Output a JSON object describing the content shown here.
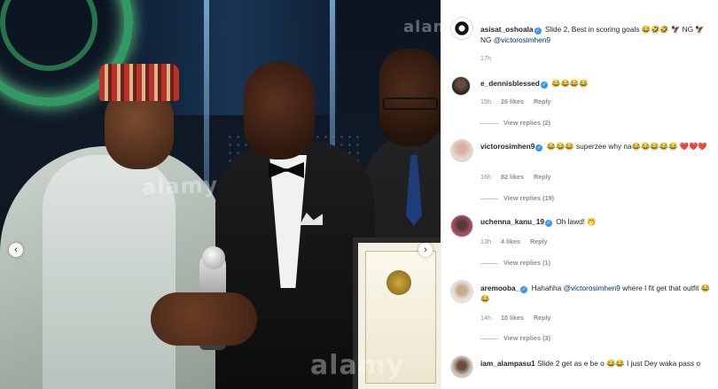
{
  "post": {
    "watermarks": [
      "alamy",
      "alamy",
      "alamy"
    ],
    "nav": {
      "prev": "‹",
      "next": "›"
    }
  },
  "comments": [
    {
      "username": "asisat_oshoala",
      "verified": true,
      "text": "Slide 2, Best in scoring goals 😂🤣🤣 🦅 NG 🦅 NG",
      "mention": "@victorosimhen9",
      "time": "17h",
      "likes": "",
      "reply": "",
      "view_replies": ""
    },
    {
      "username": "e_dennisblessed",
      "verified": true,
      "text": "😂😂😂😂",
      "mention": "",
      "time": "15h",
      "likes": "26 likes",
      "reply": "Reply",
      "view_replies": "View replies (2)"
    },
    {
      "username": "victorosimhen9",
      "verified": true,
      "text": "😂😂😂 superzee why na😂😂😂😂😂 ❤️❤️❤️",
      "mention": "",
      "time": "16h",
      "likes": "82 likes",
      "reply": "Reply",
      "view_replies": "View replies (19)"
    },
    {
      "username": "uchenna_kanu_19",
      "verified": true,
      "text": "Oh lawd! 🤭",
      "mention": "",
      "time": "13h",
      "likes": "4 likes",
      "reply": "Reply",
      "view_replies": "View replies (1)"
    },
    {
      "username": "aremooba_",
      "verified": true,
      "text_before": "Hahahha",
      "mention": "@victorosimhen9",
      "text": "where I fit get that outfit 😂😂",
      "time": "14h",
      "likes": "10 likes",
      "reply": "Reply",
      "view_replies": "View replies (3)"
    },
    {
      "username": "iam_alampasu1",
      "verified": false,
      "text": "Slide 2 get as e be o 😂😂 I just Dey waka pass o",
      "mention": "",
      "time": "",
      "likes": "",
      "reply": "",
      "view_replies": ""
    }
  ],
  "colors": {
    "verified": "#3897f0",
    "mention": "#00376b",
    "meta": "#8e8e8e"
  }
}
